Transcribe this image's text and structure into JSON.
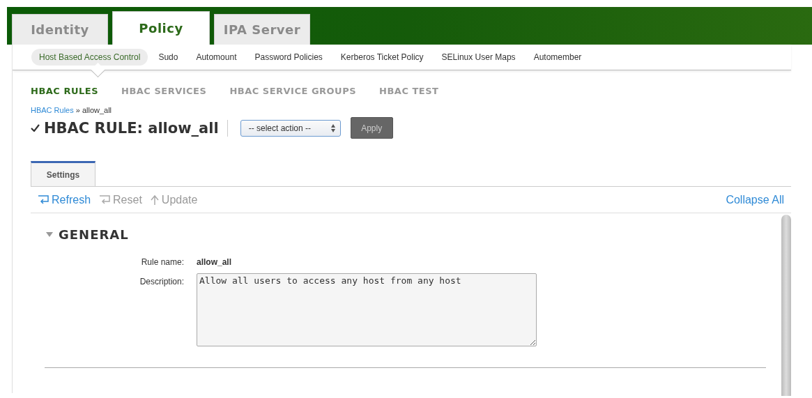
{
  "top_tabs": [
    {
      "label": "Identity",
      "selected": false
    },
    {
      "label": "Policy",
      "selected": true
    },
    {
      "label": "IPA Server",
      "selected": false
    }
  ],
  "sub_nav": [
    {
      "label": "Host Based Access Control",
      "selected": true
    },
    {
      "label": "Sudo",
      "selected": false
    },
    {
      "label": "Automount",
      "selected": false
    },
    {
      "label": "Password Policies",
      "selected": false
    },
    {
      "label": "Kerberos Ticket Policy",
      "selected": false
    },
    {
      "label": "SELinux User Maps",
      "selected": false
    },
    {
      "label": "Automember",
      "selected": false
    }
  ],
  "section_tabs": [
    {
      "label": "HBAC RULES",
      "selected": true
    },
    {
      "label": "HBAC SERVICES",
      "selected": false
    },
    {
      "label": "HBAC SERVICE GROUPS",
      "selected": false
    },
    {
      "label": "HBAC TEST",
      "selected": false
    }
  ],
  "breadcrumb": {
    "link": "HBAC Rules",
    "separator": "»",
    "current": "allow_all"
  },
  "title": {
    "prefix": "HBAC RULE:",
    "name": "allow_all",
    "enabled": true
  },
  "action_select": {
    "value": "-- select action --"
  },
  "apply_button": {
    "label": "Apply",
    "disabled": true
  },
  "facet_tabs": [
    {
      "label": "Settings",
      "selected": true
    }
  ],
  "toolbar": [
    {
      "label": "Refresh",
      "kind": "refresh",
      "disabled": false
    },
    {
      "label": "Reset",
      "kind": "reset",
      "disabled": true
    },
    {
      "label": "Update",
      "kind": "update",
      "disabled": true
    }
  ],
  "collapse_all": "Collapse All",
  "section": {
    "title": "GENERAL",
    "expanded": true,
    "fields": [
      {
        "label": "Rule name:",
        "kind": "text",
        "value": "allow_all"
      },
      {
        "label": "Description:",
        "kind": "textarea",
        "value": "Allow all users to access any host from any host"
      }
    ]
  }
}
